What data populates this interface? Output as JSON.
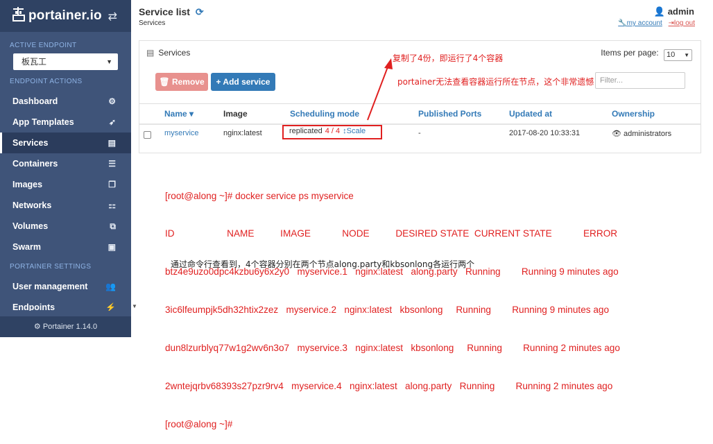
{
  "sidebar": {
    "logo_text": "portainer.io",
    "active_endpoint_label": "ACTIVE ENDPOINT",
    "endpoint_selected": "板瓦工",
    "endpoint_actions_label": "ENDPOINT ACTIONS",
    "items": [
      {
        "label": "Dashboard",
        "icon": "tachometer-icon",
        "glyph": "⚙"
      },
      {
        "label": "App Templates",
        "icon": "rocket-icon",
        "glyph": "➶"
      },
      {
        "label": "Services",
        "icon": "list-alt-icon",
        "glyph": "▤"
      },
      {
        "label": "Containers",
        "icon": "server-icon",
        "glyph": "☰"
      },
      {
        "label": "Images",
        "icon": "clone-icon",
        "glyph": "❐"
      },
      {
        "label": "Networks",
        "icon": "sitemap-icon",
        "glyph": "⚏"
      },
      {
        "label": "Volumes",
        "icon": "cubes-icon",
        "glyph": "⧉"
      },
      {
        "label": "Swarm",
        "icon": "object-group-icon",
        "glyph": "▣"
      }
    ],
    "settings_label": "PORTAINER SETTINGS",
    "settings_items": [
      {
        "label": "User management",
        "icon": "users-icon",
        "glyph": "👥"
      },
      {
        "label": "Endpoints",
        "icon": "plug-icon",
        "glyph": "⚡"
      }
    ],
    "footer": "Portainer 1.14.0"
  },
  "header": {
    "title": "Service list",
    "breadcrumb": "Services",
    "user": "admin",
    "my_account": "my account",
    "log_out": "log out"
  },
  "panel": {
    "title": "Services",
    "items_per_page_label": "Items per page:",
    "items_per_page_value": "10",
    "remove_label": "Remove",
    "add_label": "Add service",
    "filter_placeholder": "Filter...",
    "columns": [
      "Name",
      "Image",
      "Scheduling mode",
      "Published Ports",
      "Updated at",
      "Ownership"
    ],
    "row": {
      "name": "myservice",
      "image": "nginx:latest",
      "mode": "replicated",
      "running": "4",
      "separator": "/",
      "desired": "4",
      "scale": "Scale",
      "ports": "-",
      "updated": "2017-08-20 10:33:31",
      "ownership": "administrators"
    }
  },
  "annotations": {
    "note1": "复制了4份，即运行了4个容器",
    "note2": "portainer无法查看容器运行所在节点，这个非常遗憾",
    "terminal": [
      "[root@along ~]# docker service ps myservice",
      "ID                    NAME          IMAGE            NODE          DESIRED STATE  CURRENT STATE            ERROR",
      "btz4e9uzo0dpc4kzbu6y6x2y0   myservice.1   nginx:latest   along.party   Running        Running 9 minutes ago",
      "3ic6lfeumpjk5dh32htix2zez   myservice.2   nginx:latest   kbsonlong     Running        Running 9 minutes ago",
      "dun8lzurblyq77w1g2wv6n3o7   myservice.3   nginx:latest   kbsonlong     Running        Running 2 minutes ago",
      "2wntejqrbv68393s27pzr9rv4   myservice.4   nginx:latest   along.party   Running        Running 2 minutes ago",
      "[root@along ~]#"
    ],
    "summary": "通过命令行查看到，4个容器分别在两个节点along.party和kbsonlong各运行两个"
  }
}
